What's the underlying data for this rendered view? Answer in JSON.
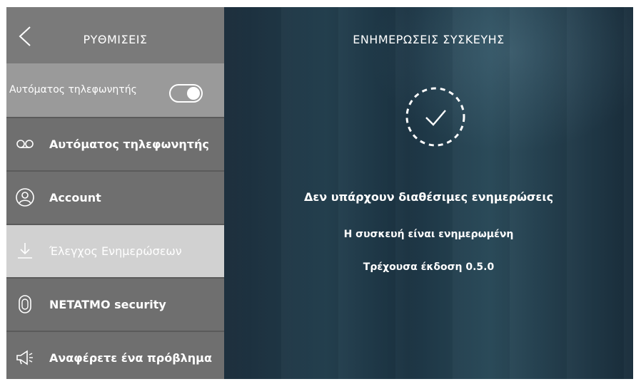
{
  "sidebar": {
    "title": "ΡΥΘΜΙΣΕΙΣ",
    "toggle": {
      "label": "Αυτόματος τηλεφωνητής",
      "on": true
    },
    "items": [
      {
        "label": "Αυτόματος τηλεφωνητής",
        "icon": "voicemail-icon"
      },
      {
        "label": "Account",
        "icon": "user-icon"
      },
      {
        "label": "Έλεγχος Ενημερώσεων",
        "icon": "download-icon",
        "active": true
      },
      {
        "label": "NETATMO security",
        "icon": "security-tag-icon"
      },
      {
        "label": "Αναφέρετε ένα πρόβλημα",
        "icon": "megaphone-icon"
      }
    ]
  },
  "main": {
    "title": "ΕΝΗΜΕΡΩΣΕΙΣ ΣΥΣΚΕΥΗΣ",
    "status_icon": "check-circle-icon",
    "message": "Δεν υπάρχουν διαθέσιμες ενημερώσεις",
    "submessage": "Η συσκευή είναι ενημερωμένη",
    "version": "Τρέχουσα έκδοση 0.5.0"
  },
  "colors": {
    "active_item": "#d1d1d1",
    "sidebar": "#6f6f6f",
    "header": "#7a7a7a",
    "toggle_row": "#9a9a9a"
  }
}
